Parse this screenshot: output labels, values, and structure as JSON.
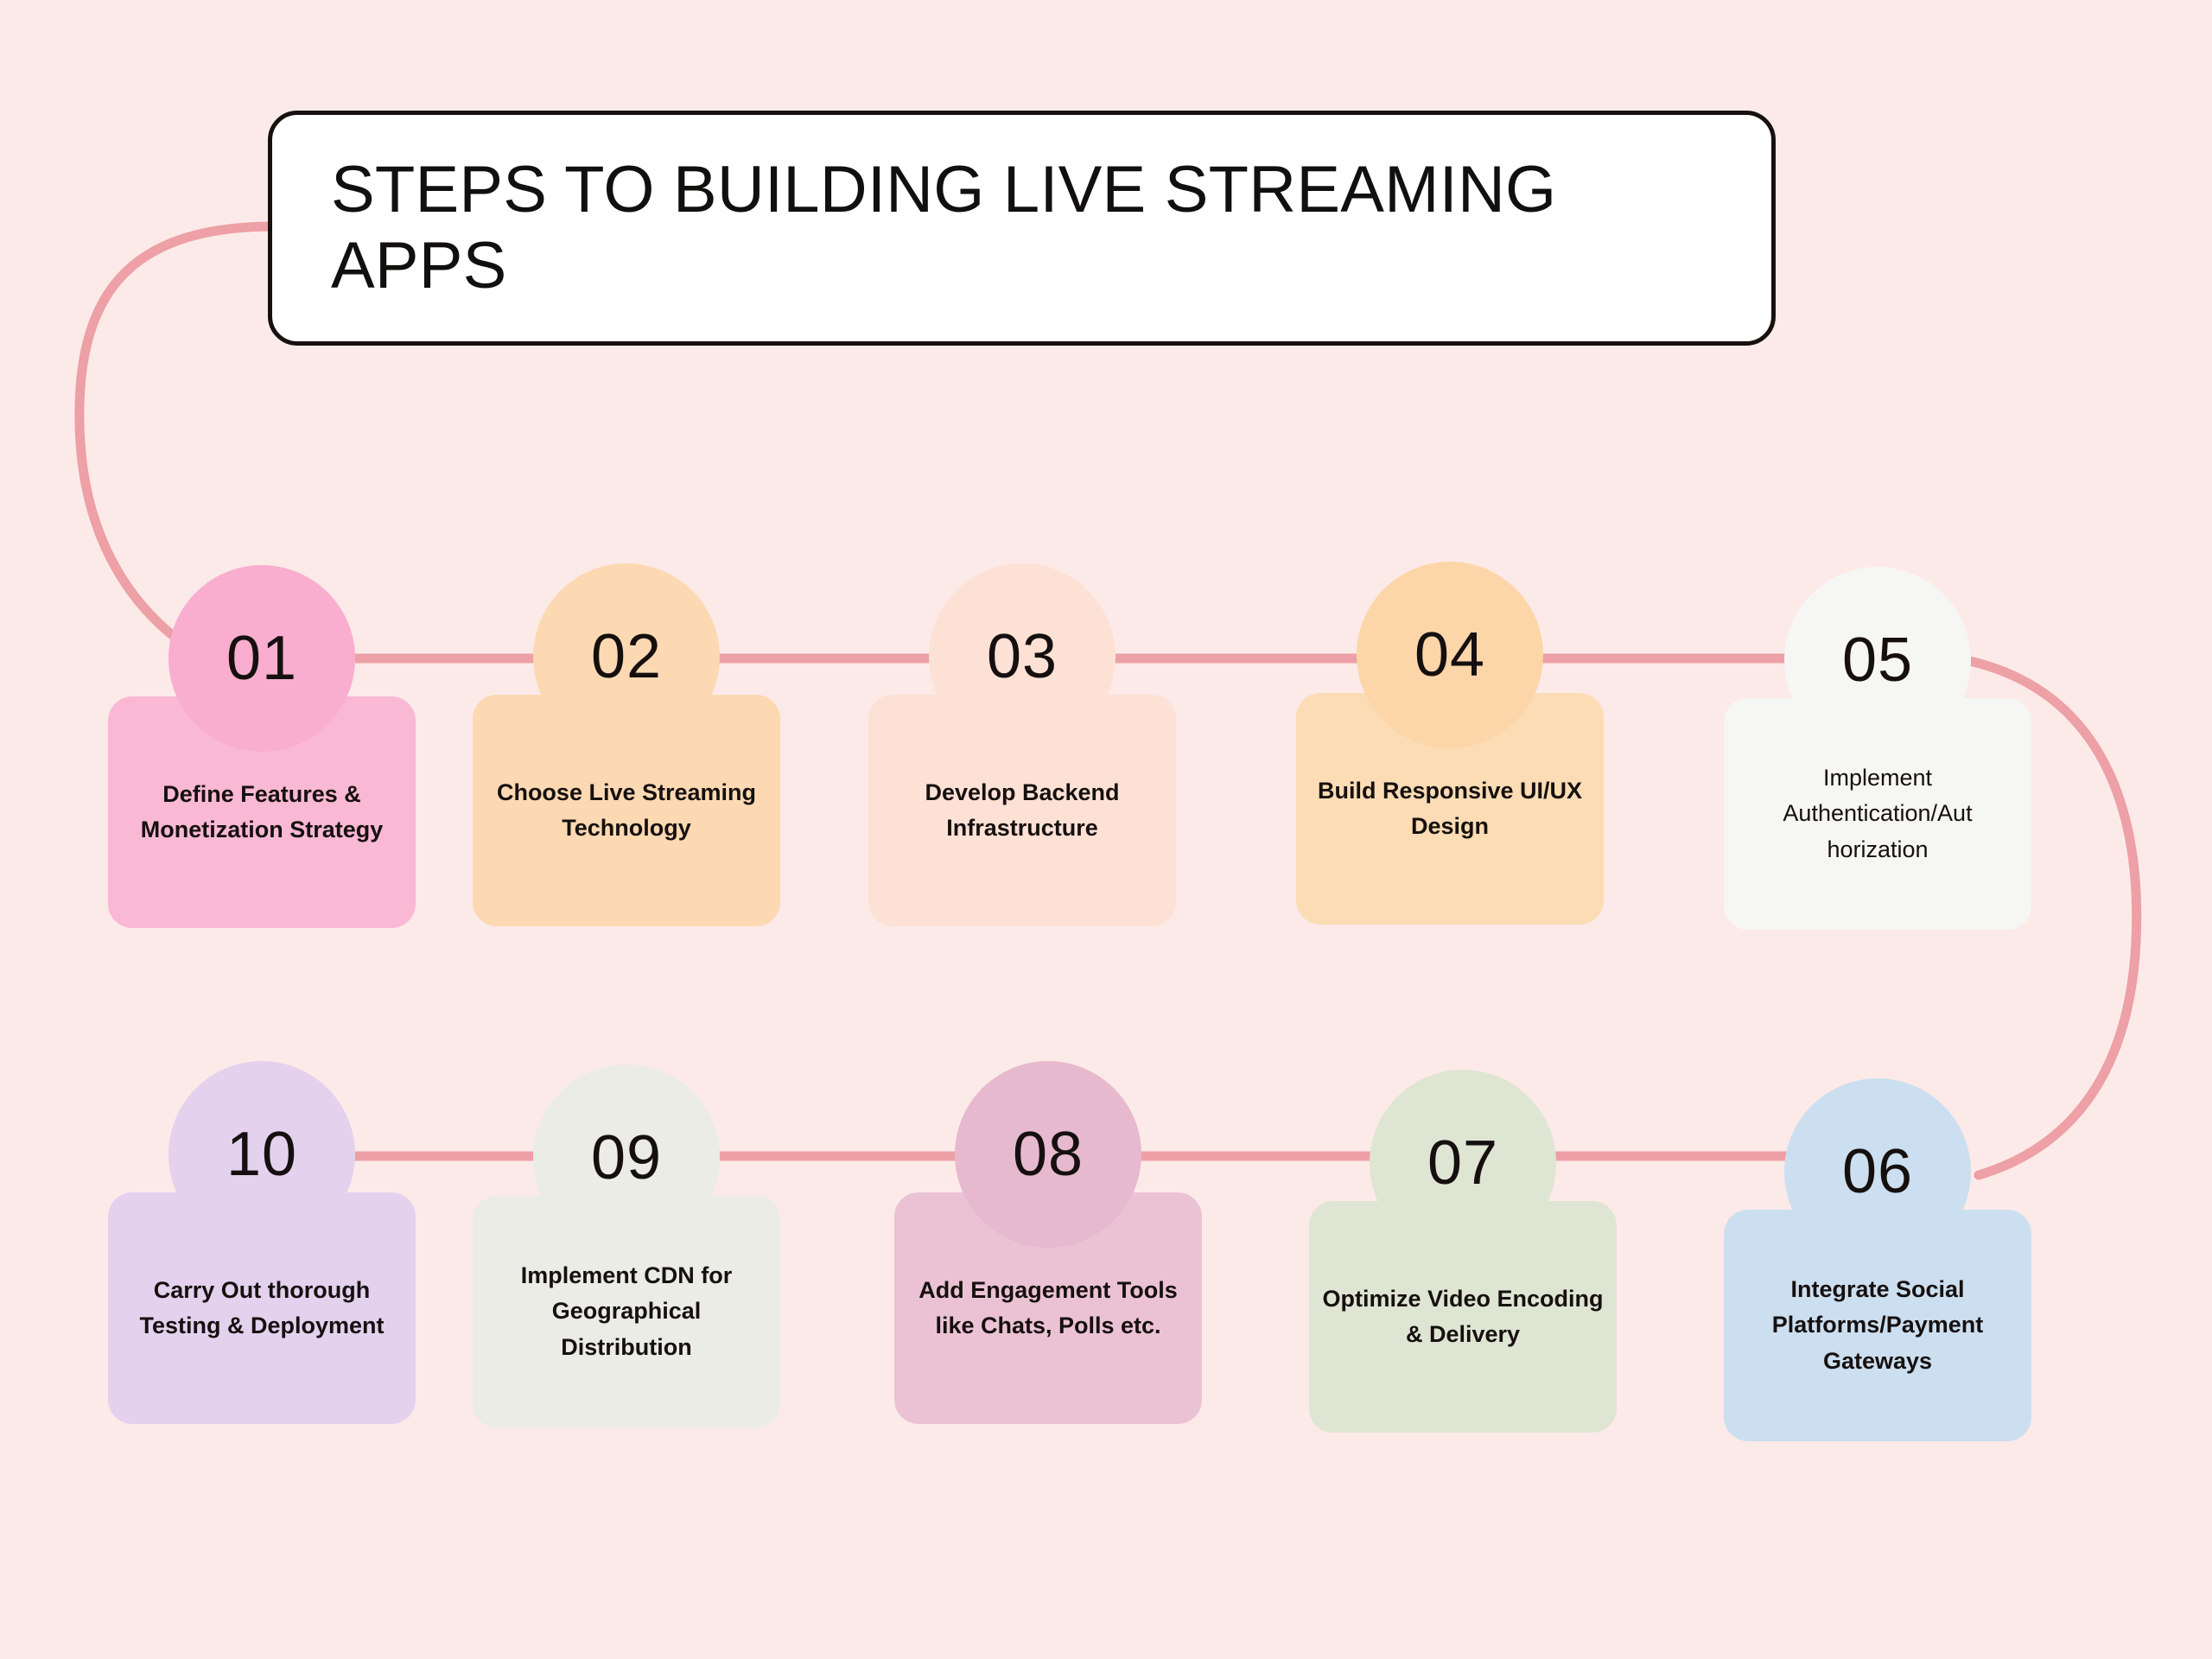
{
  "page": {
    "background_color": "#fceae8",
    "connector_color": "#eda0a5",
    "title_border_color": "#16110f",
    "title_background": "#ffffff",
    "number_text_color": "#15100f",
    "label_text_color": "#16100f"
  },
  "title": {
    "text": "STEPS TO BUILDING LIVE STREAMING APPS"
  },
  "steps": [
    {
      "number": "01",
      "label": "Define Features & Monetization Strategy",
      "circle_color": "#f9aecf",
      "card_color": "#f9b8d3",
      "row": 1
    },
    {
      "number": "02",
      "label": "Choose Live Streaming Technology",
      "circle_color": "#fcd9b2",
      "card_color": "#fcd9b2",
      "row": 1
    },
    {
      "number": "03",
      "label": "Develop Backend Infrastructure",
      "circle_color": "#fde1d5",
      "card_color": "#fde1d5",
      "row": 1
    },
    {
      "number": "04",
      "label": "Build Responsive UI/UX Design",
      "circle_color": "#fcd6a8",
      "card_color": "#fcdcb4",
      "row": 1
    },
    {
      "number": "05",
      "label": "Implement Authentication/Aut horization",
      "circle_color": "#f6f6f4",
      "card_color": "#f6f6f4",
      "row": 1
    },
    {
      "number": "06",
      "label": "Integrate Social Platforms/Payment Gateways",
      "circle_color": "#ccdff0",
      "card_color": "#ccdff0",
      "row": 2
    },
    {
      "number": "07",
      "label": "Optimize Video Encoding & Delivery",
      "circle_color": "#dfe5d3",
      "card_color": "#dfe5d3",
      "row": 2
    },
    {
      "number": "08",
      "label": "Add Engagement Tools like Chats, Polls etc.",
      "circle_color": "#e7b9ce",
      "card_color": "#ebc2d4",
      "row": 2
    },
    {
      "number": "09",
      "label": "Implement CDN for Geographical Distribution",
      "circle_color": "#eaece5",
      "card_color": "#eaece5",
      "row": 2
    },
    {
      "number": "10",
      "label": "Carry Out thorough Testing & Deployment",
      "circle_color": "#e4d1ee",
      "card_color": "#e4d1ee",
      "row": 2
    }
  ]
}
